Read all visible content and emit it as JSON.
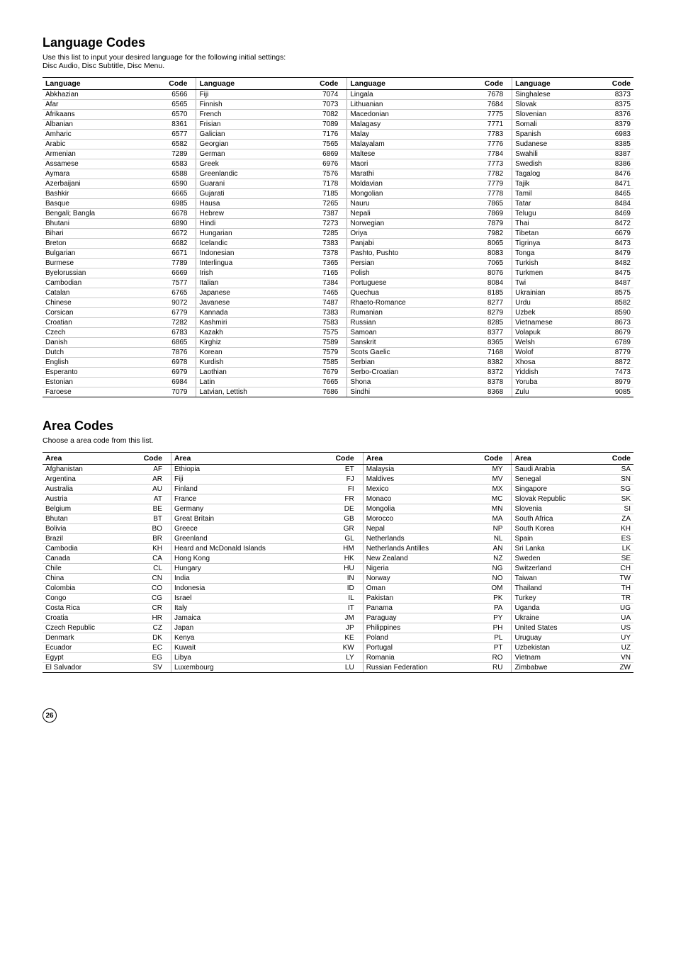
{
  "language_section": {
    "title": "Language Codes",
    "description": "Use this list to input your desired language for the following initial settings:",
    "description2": "Disc Audio, Disc Subtitle, Disc Menu.",
    "columns": [
      "Language",
      "Code",
      "Language",
      "Code",
      "Language",
      "Code",
      "Language",
      "Code"
    ],
    "rows": [
      [
        "Abkhazian",
        "6566",
        "Fiji",
        "7074",
        "Lingala",
        "7678",
        "Singhalese",
        "8373"
      ],
      [
        "Afar",
        "6565",
        "Finnish",
        "7073",
        "Lithuanian",
        "7684",
        "Slovak",
        "8375"
      ],
      [
        "Afrikaans",
        "6570",
        "French",
        "7082",
        "Macedonian",
        "7775",
        "Slovenian",
        "8376"
      ],
      [
        "Albanian",
        "8361",
        "Frisian",
        "7089",
        "Malagasy",
        "7771",
        "Somali",
        "8379"
      ],
      [
        "Amharic",
        "6577",
        "Galician",
        "7176",
        "Malay",
        "7783",
        "Spanish",
        "6983"
      ],
      [
        "Arabic",
        "6582",
        "Georgian",
        "7565",
        "Malayalam",
        "7776",
        "Sudanese",
        "8385"
      ],
      [
        "Armenian",
        "7289",
        "German",
        "6869",
        "Maltese",
        "7784",
        "Swahili",
        "8387"
      ],
      [
        "Assamese",
        "6583",
        "Greek",
        "6976",
        "Maori",
        "7773",
        "Swedish",
        "8386"
      ],
      [
        "Aymara",
        "6588",
        "Greenlandic",
        "7576",
        "Marathi",
        "7782",
        "Tagalog",
        "8476"
      ],
      [
        "Azerbaijani",
        "6590",
        "Guarani",
        "7178",
        "Moldavian",
        "7779",
        "Tajik",
        "8471"
      ],
      [
        "Bashkir",
        "6665",
        "Gujarati",
        "7185",
        "Mongolian",
        "7778",
        "Tamil",
        "8465"
      ],
      [
        "Basque",
        "6985",
        "Hausa",
        "7265",
        "Nauru",
        "7865",
        "Tatar",
        "8484"
      ],
      [
        "Bengali; Bangla",
        "6678",
        "Hebrew",
        "7387",
        "Nepali",
        "7869",
        "Telugu",
        "8469"
      ],
      [
        "Bhutani",
        "6890",
        "Hindi",
        "7273",
        "Norwegian",
        "7879",
        "Thai",
        "8472"
      ],
      [
        "Bihari",
        "6672",
        "Hungarian",
        "7285",
        "Oriya",
        "7982",
        "Tibetan",
        "6679"
      ],
      [
        "Breton",
        "6682",
        "Icelandic",
        "7383",
        "Panjabi",
        "8065",
        "Tigrinya",
        "8473"
      ],
      [
        "Bulgarian",
        "6671",
        "Indonesian",
        "7378",
        "Pashto, Pushto",
        "8083",
        "Tonga",
        "8479"
      ],
      [
        "Burmese",
        "7789",
        "Interlingua",
        "7365",
        "Persian",
        "7065",
        "Turkish",
        "8482"
      ],
      [
        "Byelorussian",
        "6669",
        "Irish",
        "7165",
        "Polish",
        "8076",
        "Turkmen",
        "8475"
      ],
      [
        "Cambodian",
        "7577",
        "Italian",
        "7384",
        "Portuguese",
        "8084",
        "Twi",
        "8487"
      ],
      [
        "Catalan",
        "6765",
        "Japanese",
        "7465",
        "Quechua",
        "8185",
        "Ukrainian",
        "8575"
      ],
      [
        "Chinese",
        "9072",
        "Javanese",
        "7487",
        "Rhaeto-Romance",
        "8277",
        "Urdu",
        "8582"
      ],
      [
        "Corsican",
        "6779",
        "Kannada",
        "7383",
        "Rumanian",
        "8279",
        "Uzbek",
        "8590"
      ],
      [
        "Croatian",
        "7282",
        "Kashmiri",
        "7583",
        "Russian",
        "8285",
        "Vietnamese",
        "8673"
      ],
      [
        "Czech",
        "6783",
        "Kazakh",
        "7575",
        "Samoan",
        "8377",
        "Volapuk",
        "8679"
      ],
      [
        "Danish",
        "6865",
        "Kirghiz",
        "7589",
        "Sanskrit",
        "8365",
        "Welsh",
        "6789"
      ],
      [
        "Dutch",
        "7876",
        "Korean",
        "7579",
        "Scots Gaelic",
        "7168",
        "Wolof",
        "8779"
      ],
      [
        "English",
        "6978",
        "Kurdish",
        "7585",
        "Serbian",
        "8382",
        "Xhosa",
        "8872"
      ],
      [
        "Esperanto",
        "6979",
        "Laothian",
        "7679",
        "Serbo-Croatian",
        "8372",
        "Yiddish",
        "7473"
      ],
      [
        "Estonian",
        "6984",
        "Latin",
        "7665",
        "Shona",
        "8378",
        "Yoruba",
        "8979"
      ],
      [
        "Faroese",
        "7079",
        "Latvian, Lettish",
        "7686",
        "Sindhi",
        "8368",
        "Zulu",
        "9085"
      ]
    ]
  },
  "area_section": {
    "title": "Area Codes",
    "description": "Choose a area code from this list.",
    "columns": [
      "Area",
      "Code",
      "Area",
      "Code",
      "Area",
      "Code",
      "Area",
      "Code"
    ],
    "rows": [
      [
        "Afghanistan",
        "AF",
        "Ethiopia",
        "ET",
        "Malaysia",
        "MY",
        "Saudi Arabia",
        "SA"
      ],
      [
        "Argentina",
        "AR",
        "Fiji",
        "FJ",
        "Maldives",
        "MV",
        "Senegal",
        "SN"
      ],
      [
        "Australia",
        "AU",
        "Finland",
        "FI",
        "Mexico",
        "MX",
        "Singapore",
        "SG"
      ],
      [
        "Austria",
        "AT",
        "France",
        "FR",
        "Monaco",
        "MC",
        "Slovak Republic",
        "SK"
      ],
      [
        "Belgium",
        "BE",
        "Germany",
        "DE",
        "Mongolia",
        "MN",
        "Slovenia",
        "SI"
      ],
      [
        "Bhutan",
        "BT",
        "Great Britain",
        "GB",
        "Morocco",
        "MA",
        "South Africa",
        "ZA"
      ],
      [
        "Bolivia",
        "BO",
        "Greece",
        "GR",
        "Nepal",
        "NP",
        "South Korea",
        "KH"
      ],
      [
        "Brazil",
        "BR",
        "Greenland",
        "GL",
        "Netherlands",
        "NL",
        "Spain",
        "ES"
      ],
      [
        "Cambodia",
        "KH",
        "Heard and McDonald Islands",
        "HM",
        "Netherlands Antilles",
        "AN",
        "Sri Lanka",
        "LK"
      ],
      [
        "Canada",
        "CA",
        "Hong Kong",
        "HK",
        "New Zealand",
        "NZ",
        "Sweden",
        "SE"
      ],
      [
        "Chile",
        "CL",
        "Hungary",
        "HU",
        "Nigeria",
        "NG",
        "Switzerland",
        "CH"
      ],
      [
        "China",
        "CN",
        "India",
        "IN",
        "Norway",
        "NO",
        "Taiwan",
        "TW"
      ],
      [
        "Colombia",
        "CO",
        "Indonesia",
        "ID",
        "Oman",
        "OM",
        "Thailand",
        "TH"
      ],
      [
        "Congo",
        "CG",
        "Israel",
        "IL",
        "Pakistan",
        "PK",
        "Turkey",
        "TR"
      ],
      [
        "Costa Rica",
        "CR",
        "Italy",
        "IT",
        "Panama",
        "PA",
        "Uganda",
        "UG"
      ],
      [
        "Croatia",
        "HR",
        "Jamaica",
        "JM",
        "Paraguay",
        "PY",
        "Ukraine",
        "UA"
      ],
      [
        "Czech Republic",
        "CZ",
        "Japan",
        "JP",
        "Philippines",
        "PH",
        "United States",
        "US"
      ],
      [
        "Denmark",
        "DK",
        "Kenya",
        "KE",
        "Poland",
        "PL",
        "Uruguay",
        "UY"
      ],
      [
        "Ecuador",
        "EC",
        "Kuwait",
        "KW",
        "Portugal",
        "PT",
        "Uzbekistan",
        "UZ"
      ],
      [
        "Egypt",
        "EG",
        "Libya",
        "LY",
        "Romania",
        "RO",
        "Vietnam",
        "VN"
      ],
      [
        "El Salvador",
        "SV",
        "Luxembourg",
        "LU",
        "Russian Federation",
        "RU",
        "Zimbabwe",
        "ZW"
      ]
    ]
  },
  "page_number": "26"
}
